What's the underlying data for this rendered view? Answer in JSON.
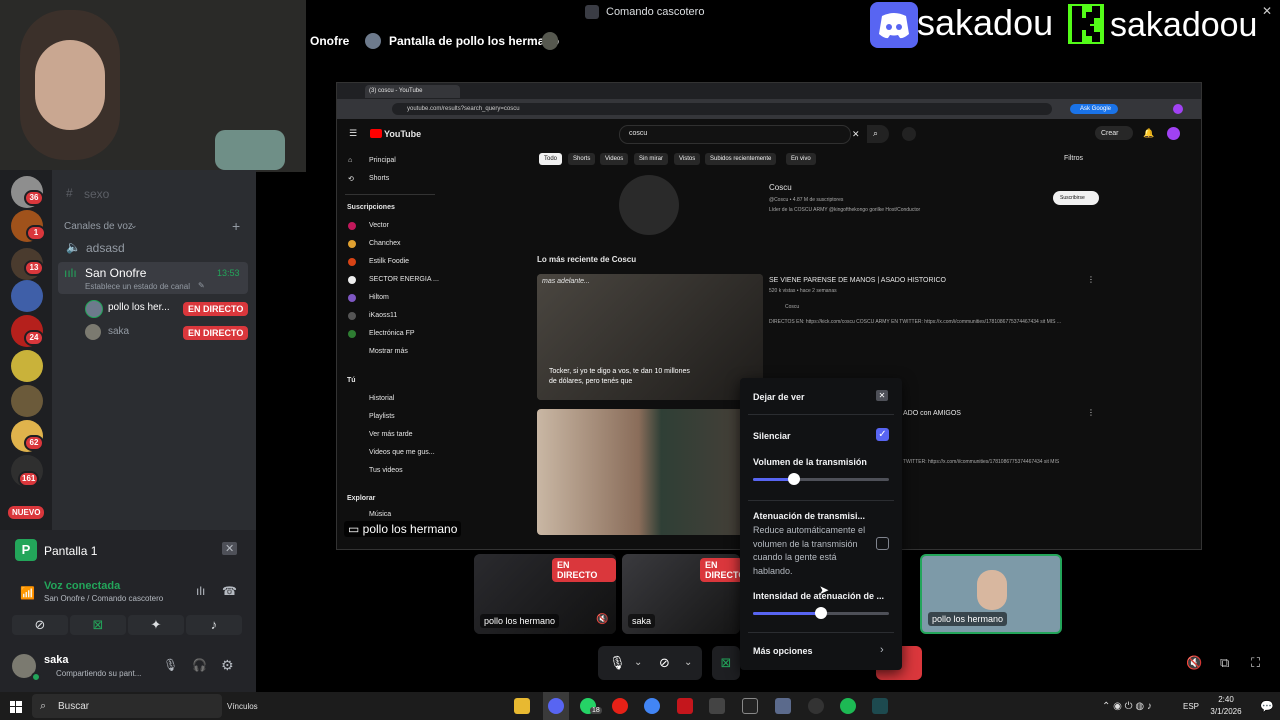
{
  "window": {
    "title": "Comando cascotero"
  },
  "stage_header": {
    "channel": "Onofre",
    "stream_title": "Pantalla de pollo los hermano"
  },
  "overlay": {
    "discord_name": "sakadou",
    "kick_name": "sakadoou"
  },
  "rail": {
    "badges": [
      "36",
      "1",
      "13",
      "24",
      "62",
      "161"
    ],
    "new_label": "NUEVO"
  },
  "sidebar": {
    "text_channel": "sexo",
    "voice_header": "Canales de voz",
    "voice_channels": [
      {
        "name": "adsasd"
      },
      {
        "name": "San Onofre",
        "time": "13:53",
        "status": "Establece un estado de canal"
      }
    ],
    "members": [
      {
        "name": "pollo los her...",
        "badge": "EN DIRECTO"
      },
      {
        "name": "saka",
        "badge": "EN DIRECTO"
      }
    ]
  },
  "panel": {
    "screen_share": "Pantalla 1",
    "voice_status": "Voz conectada",
    "voice_location": "San Onofre / Comando cascotero",
    "user_name": "saka",
    "user_status": "Compartiendo su pant..."
  },
  "browser": {
    "tab": "(3) coscu - YouTube",
    "url": "youtube.com/results?search_query=coscu",
    "ask_google": "Ask Google",
    "logo": "YouTube",
    "search_value": "coscu",
    "create": "Crear",
    "filters": [
      "Todo",
      "Shorts",
      "Videos",
      "Sin mirar",
      "Vistos",
      "Subidos recientemente",
      "En vivo"
    ],
    "filters_label": "Filtros",
    "nav": [
      "Principal",
      "Shorts"
    ],
    "subs_header": "Suscripciones",
    "subs": [
      "Vector",
      "Chanchex",
      "Estilk Foodie",
      "SECTOR ENERGIA ...",
      "Hiltom",
      "iKaoss11",
      "Electrónica FP"
    ],
    "more": "Mostrar más",
    "you_header": "Tú",
    "you": [
      "Historial",
      "Playlists",
      "Ver más tarde",
      "Videos que me gus...",
      "Tus videos"
    ],
    "explore_header": "Explorar",
    "explore": [
      "Música"
    ],
    "channel_name": "Coscu",
    "channel_meta": "@Coscu • 4.87 M de suscriptores",
    "channel_desc": "Líder de la COSCU ARMY @kingofthekongo gorilke Host/Conductor",
    "subscribe": "Suscribirse",
    "section": "Lo más reciente de Coscu",
    "video1": {
      "title": "SE VIENE PARENSE DE MANOS | ASADO HISTORICO",
      "meta": "520 k vistas • hace 2 semanas",
      "channel": "Coscu",
      "desc": "DIRECTOS EN: https://kick.com/coscu COSCU ARMY EN TWITTER: https://x.com/i/communities/1781086775374467434 sit MIS ...",
      "overlay_top": "mas adelante...",
      "caption": "Tocker, si yo te digo a vos, te dan 10 millones de dólares, pero tenés que"
    },
    "video2": {
      "title_suffix": "ADO con AMIGOS",
      "desc": "TWITTER: https://x.com/i/communities/1781086775374467434 sit MIS"
    }
  },
  "stream_label": "pollo los hermano",
  "menu": {
    "stop": "Dejar de ver",
    "mute": "Silenciar",
    "mute_checked": true,
    "volume": "Volumen de la transmisión",
    "volume_level": 0.3,
    "attenuation": "Atenuación de transmisi...",
    "attenuation_desc": "Reduce automáticamente el volumen de la transmisión cuando la gente está hablando.",
    "intensity": "Intensidad de atenuación de ...",
    "intensity_level": 0.5,
    "more": "Más opciones"
  },
  "thumbs": [
    {
      "label": "pollo los hermano",
      "live": "EN DIRECTO"
    },
    {
      "label": "saka",
      "live": "EN DIRECTO"
    },
    {
      "label": "pollo los hermano"
    }
  ],
  "taskbar": {
    "search": "Buscar",
    "links": "Vínculos",
    "lang": "ESP",
    "time": "2:40",
    "date": "3/1/2026",
    "badge": "18"
  },
  "colors": {
    "accent": "#5865f2",
    "live": "#da373c",
    "green": "#23a55a",
    "youtube_red": "#ff0000"
  }
}
